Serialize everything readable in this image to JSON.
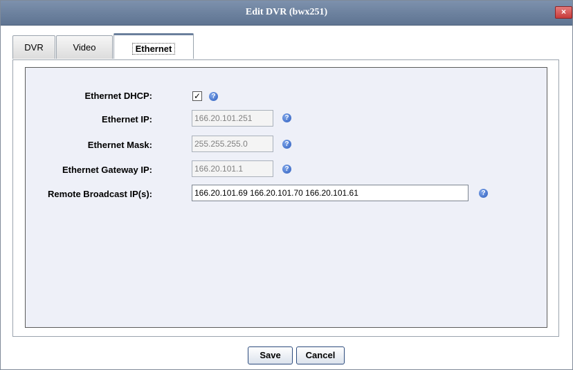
{
  "window": {
    "title": "Edit DVR (bwx251)",
    "close_label": "×"
  },
  "tabs": [
    {
      "label": "DVR"
    },
    {
      "label": "Video"
    },
    {
      "label": "Ethernet",
      "active": true
    }
  ],
  "form": {
    "dhcp": {
      "label": "Ethernet DHCP:",
      "checked": true,
      "check_glyph": "✓"
    },
    "ip": {
      "label": "Ethernet IP:",
      "value": "166.20.101.251"
    },
    "mask": {
      "label": "Ethernet Mask:",
      "value": "255.255.255.0"
    },
    "gateway": {
      "label": "Ethernet Gateway IP:",
      "value": "166.20.101.1"
    },
    "broadcast": {
      "label": "Remote Broadcast IP(s):",
      "value": "166.20.101.69 166.20.101.70 166.20.101.61"
    },
    "help_glyph": "?"
  },
  "buttons": {
    "save": "Save",
    "cancel": "Cancel"
  },
  "colors": {
    "titlebar": "#6a7f9c",
    "panel_bg": "#eef0f8",
    "help_icon": "#2d5dbd",
    "close": "#c73b3b"
  },
  "icons": {
    "help": "help-icon",
    "close": "close-icon",
    "check": "check-icon"
  }
}
